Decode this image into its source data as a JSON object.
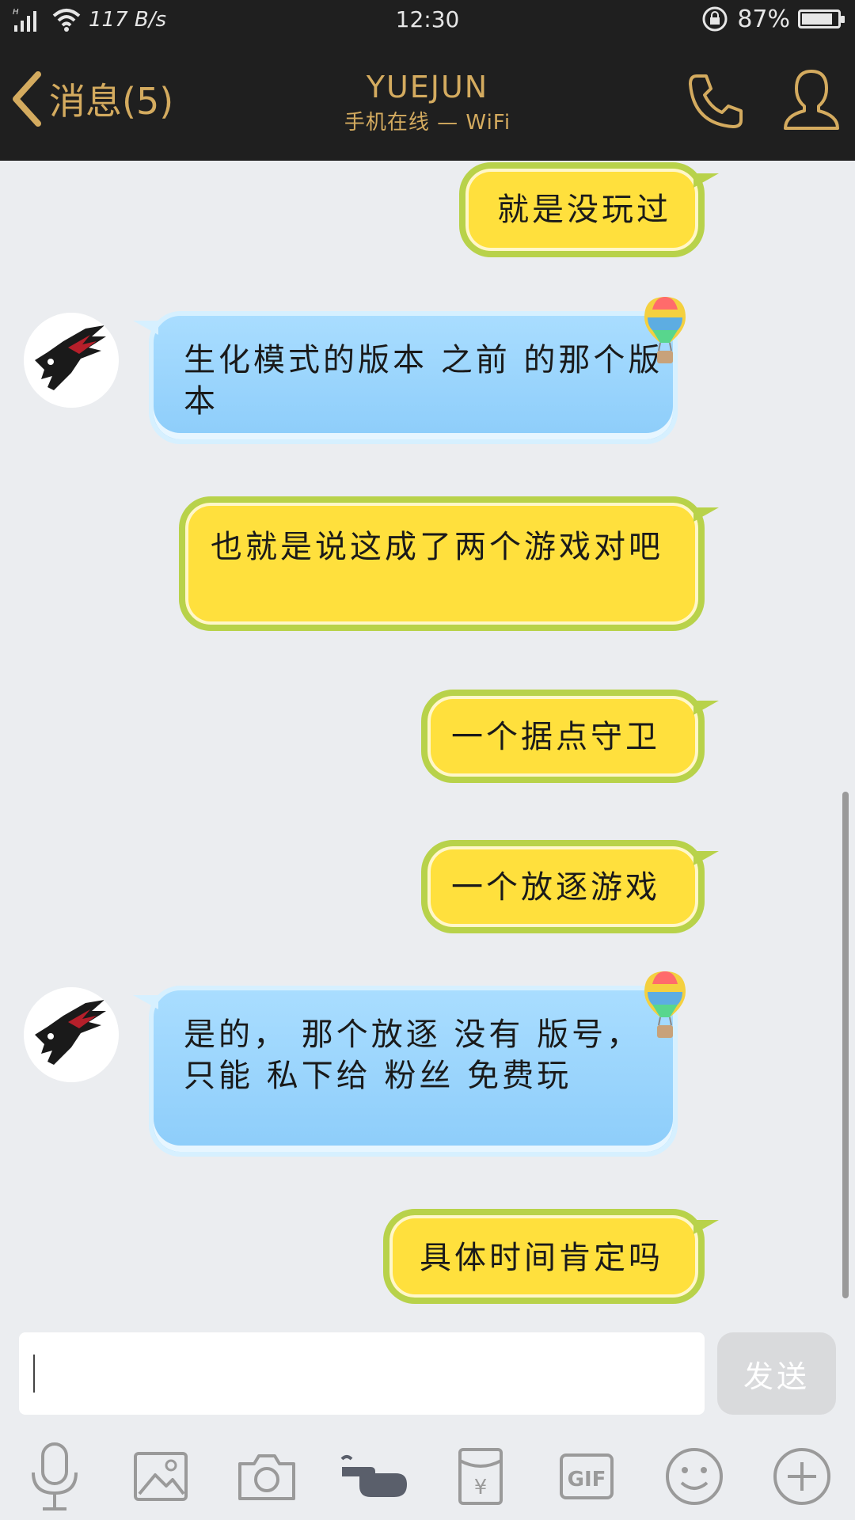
{
  "status_bar": {
    "signal": "H",
    "network_speed": "117 B/s",
    "time": "12:30",
    "battery_percent": "87%",
    "battery_level": 0.87
  },
  "header": {
    "back_label": "消息(5)",
    "title": "YUEJUN",
    "subtitle": "手机在线 — WiFi",
    "call_icon": "phone-icon",
    "profile_icon": "person-icon",
    "accent_color": "#d4ab5f",
    "background_color": "#1f1f1f"
  },
  "messages": [
    {
      "direction": "out",
      "text": "就是没玩过"
    },
    {
      "direction": "in",
      "text": "生化模式的版本 之前 的那个版本"
    },
    {
      "direction": "out",
      "text": "也就是说这成了两个游戏对吧"
    },
    {
      "direction": "out",
      "text": "一个据点守卫"
    },
    {
      "direction": "out",
      "text": "一个放逐游戏"
    },
    {
      "direction": "in",
      "text": "是的， 那个放逐 没有 版号， 只能 私下给 粉丝 免费玩"
    },
    {
      "direction": "out",
      "text": "具体时间肯定吗"
    }
  ],
  "composer": {
    "placeholder": "",
    "send_label": "发送"
  },
  "toolbar": [
    {
      "icon": "microphone-icon"
    },
    {
      "icon": "image-icon"
    },
    {
      "icon": "camera-icon"
    },
    {
      "icon": "poke-hand-icon"
    },
    {
      "icon": "red-envelope-icon"
    },
    {
      "icon": "gif-icon",
      "label": "GIF"
    },
    {
      "icon": "emoji-icon"
    },
    {
      "icon": "plus-icon"
    }
  ],
  "colors": {
    "outgoing_bubble": "#ffe03d",
    "outgoing_border": "#b8d24a",
    "incoming_bubble": "#9ad3fb",
    "chat_background": "#ebedf0"
  }
}
